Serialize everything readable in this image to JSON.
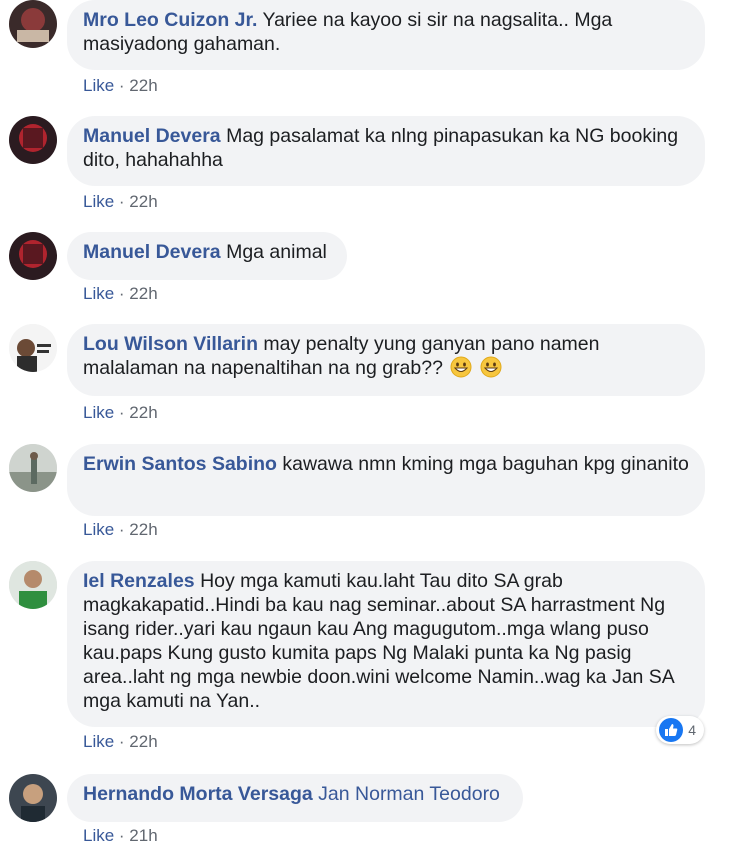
{
  "like_label": "Like",
  "colors": {
    "author": "#385898",
    "bubble": "#f2f3f5",
    "meta": "#616770",
    "like_badge": "#1877f2"
  },
  "comments": [
    {
      "author": "Mro Leo Cuizon Jr.",
      "text": "Yariee na kayoo si sir na nagsalita.. Mga masiyadong gahaman.",
      "time": "22h"
    },
    {
      "author": "Manuel Devera",
      "text": "Mag pasalamat ka nlng pinapasukan ka NG booking dito, hahahahha",
      "time": "22h"
    },
    {
      "author": "Manuel Devera",
      "text": "Mga animal",
      "time": "22h"
    },
    {
      "author": "Lou Wilson Villarin",
      "text": "may penalty yung ganyan pano namen malalaman na napenaltihan na ng grab??",
      "emoji": "grinning-face-emoji",
      "time": "22h"
    },
    {
      "author": "Erwin Santos Sabino",
      "text": "kawawa nmn kming mga baguhan kpg ginanito",
      "time": "22h"
    },
    {
      "author": "Iel Renzales",
      "text": "Hoy mga kamuti kau.laht Tau dito SA grab magkakapatid..Hindi ba kau nag seminar..about SA harrastment Ng isang rider..yari kau ngaun kau Ang magugutom..mga wlang puso kau.paps Kung gusto kumita paps Ng Malaki punta ka Ng pasig area..laht ng mga newbie doon.wini welcome Namin..wag ka Jan SA mga kamuti na Yan..",
      "time": "22h",
      "reactions": {
        "icon": "thumbs-up-icon",
        "count": "4"
      }
    },
    {
      "author": "Hernando Morta Versaga",
      "text": "Jan Norman Teodoro",
      "time": "21h"
    }
  ]
}
